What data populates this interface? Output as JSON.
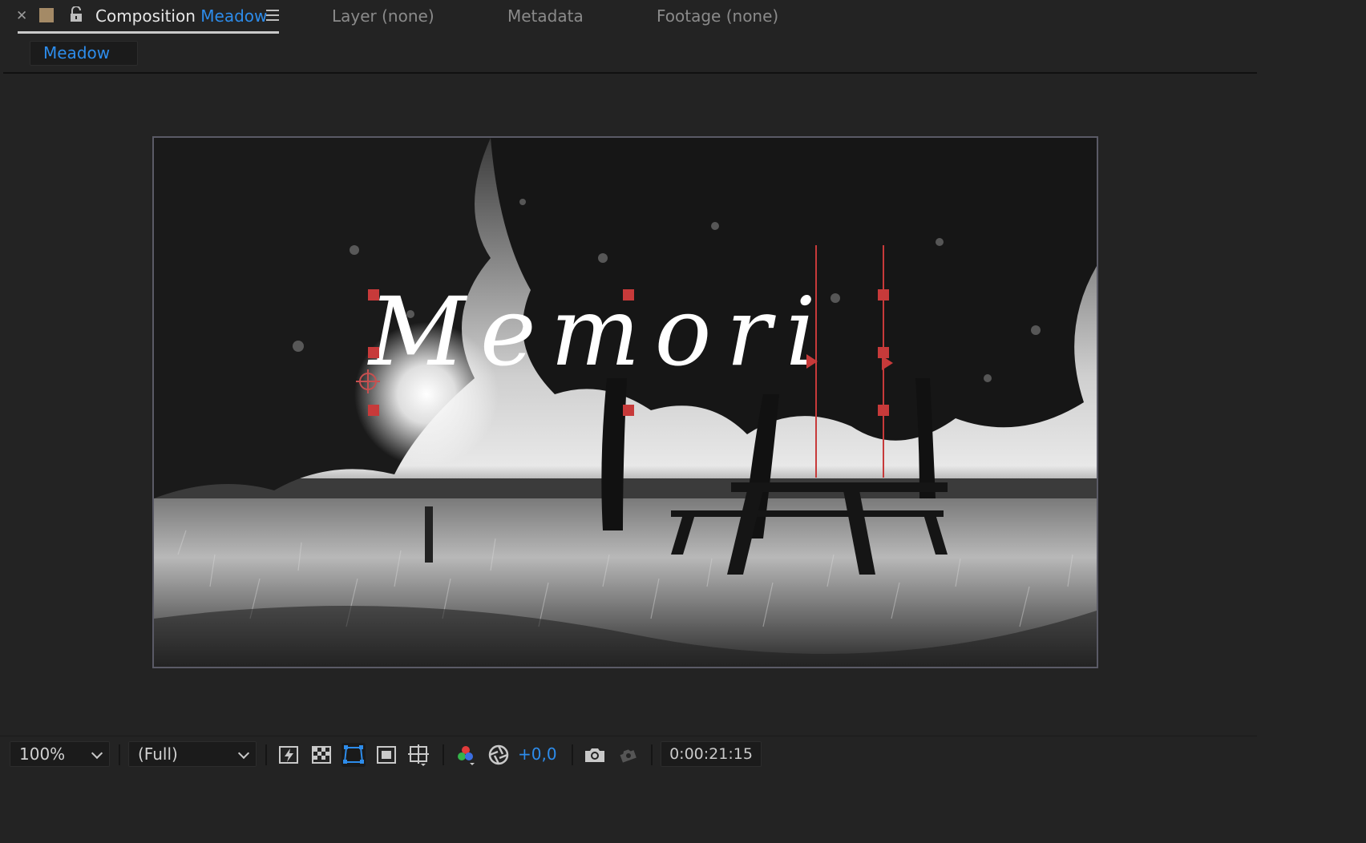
{
  "tabs": {
    "composition": {
      "prefix": "Composition",
      "name": "Meadow"
    },
    "layer": "Layer (none)",
    "metadata": "Metadata",
    "footage": "Footage (none)"
  },
  "breadcrumb": {
    "current": "Meadow"
  },
  "viewer": {
    "overlay_text": "Memori"
  },
  "toolbar": {
    "zoom": "100%",
    "resolution": "(Full)",
    "exposure": "+0,0",
    "timecode": "0:00:21:15"
  },
  "colors": {
    "accent": "#2d8ceb",
    "handle": "#c73a3a",
    "panel": "#232323",
    "comp_swatch": "#a48a66"
  },
  "icons": {
    "close": "close-icon",
    "lock": "unlock-icon",
    "menu": "hamburger-menu-icon",
    "fast_previews": "fast-previews-icon",
    "transparency_grid": "transparency-grid-icon",
    "mask_path": "mask-visibility-icon",
    "region_of_interest": "region-of-interest-icon",
    "grid_guides": "grid-guides-icon",
    "channels": "rgb-channels-icon",
    "reset_exposure": "reset-exposure-icon",
    "snapshot": "camera-snapshot-icon",
    "show_snapshot": "show-snapshot-icon"
  }
}
